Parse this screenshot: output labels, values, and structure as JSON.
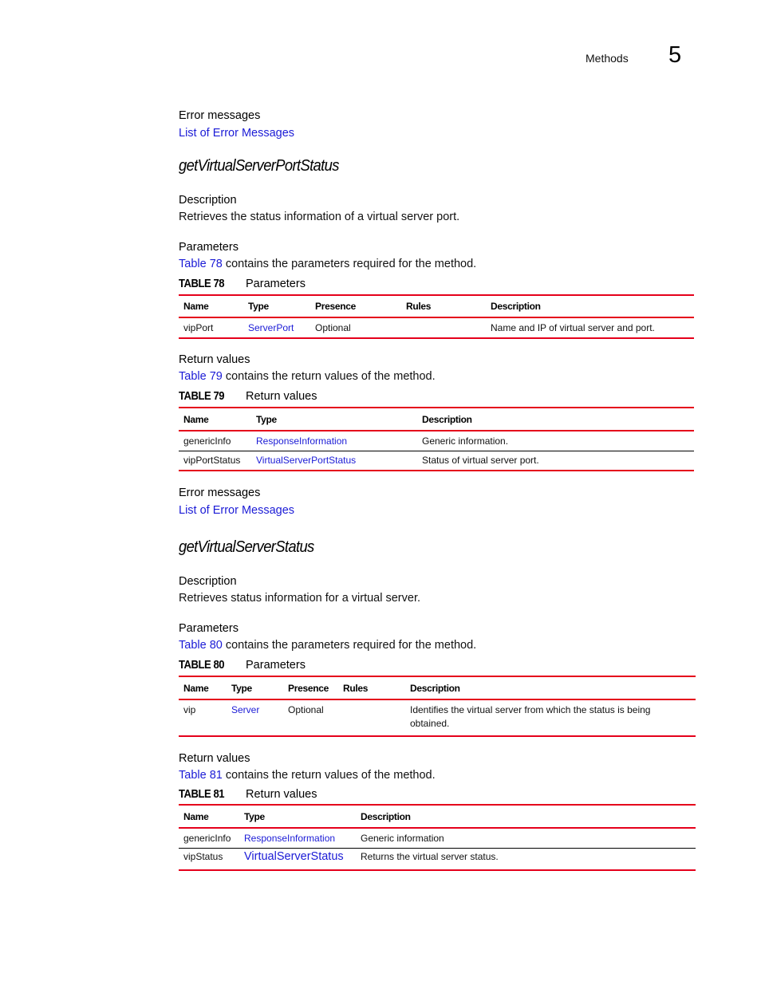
{
  "header": {
    "section": "Methods",
    "chapter_number": "5"
  },
  "top": {
    "error_heading": "Error messages",
    "error_link": "List of Error Messages"
  },
  "methods": [
    {
      "title": "getVirtualServerPortStatus",
      "description_heading": "Description",
      "description": "Retrieves the status information of a virtual server port.",
      "parameters_heading": "Parameters",
      "parameters_ref_link": "Table 78",
      "parameters_ref_text": " contains the parameters required for the method.",
      "param_table": {
        "number": "TABLE 78",
        "caption": "Parameters",
        "columns": [
          "Name",
          "Type",
          "Presence",
          "Rules",
          "Description"
        ],
        "rows": [
          {
            "name": "vipPort",
            "type": "ServerPort",
            "presence": "Optional",
            "rules": "",
            "description": "Name and IP of virtual server and port."
          }
        ]
      },
      "return_heading": "Return values",
      "return_ref_link": "Table 79",
      "return_ref_text": " contains the return values of the method.",
      "return_table": {
        "number": "TABLE 79",
        "caption": "Return values",
        "columns": [
          "Name",
          "Type",
          "Description"
        ],
        "rows": [
          {
            "name": "genericInfo",
            "type": "ResponseInformation",
            "description": "Generic information."
          },
          {
            "name": "vipPortStatus",
            "type": "VirtualServerPortStatus",
            "description": "Status of virtual server port."
          }
        ]
      },
      "error_heading": "Error messages",
      "error_link": "List of Error Messages"
    },
    {
      "title": "getVirtualServerStatus",
      "description_heading": "Description",
      "description": "Retrieves status information for a virtual server.",
      "parameters_heading": "Parameters",
      "parameters_ref_link": "Table 80",
      "parameters_ref_text": " contains the parameters required for the method.",
      "param_table": {
        "number": "TABLE 80",
        "caption": "Parameters",
        "columns": [
          "Name",
          "Type",
          "Presence",
          "Rules",
          "Description"
        ],
        "rows": [
          {
            "name": "vip",
            "type": "Server",
            "presence": "Optional",
            "rules": "",
            "description": "Identifies the virtual server from which the status is being obtained."
          }
        ]
      },
      "return_heading": "Return values",
      "return_ref_link": "Table 81",
      "return_ref_text": " contains the return values of the method.",
      "return_table": {
        "number": "TABLE 81",
        "caption": "Return values",
        "columns": [
          "Name",
          "Type",
          "Description"
        ],
        "rows": [
          {
            "name": "genericInfo",
            "type": "ResponseInformation",
            "description": "Generic information"
          },
          {
            "name": "vipStatus",
            "type": "VirtualServerStatus",
            "description": "Returns the virtual server status."
          }
        ]
      }
    }
  ],
  "colors": {
    "link": "#1b1bd6",
    "table_rule": "#e5001b"
  }
}
